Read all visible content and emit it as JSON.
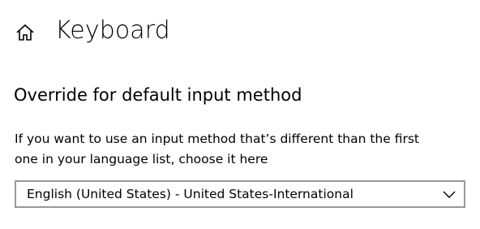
{
  "header": {
    "home_icon": "home-icon",
    "title": "Keyboard"
  },
  "section": {
    "title": "Override for default input method",
    "description_line1": "If you want to use an input method that’s different than the first",
    "description_line2": "one in your language list, choose it here"
  },
  "input_method_select": {
    "selected_value": "English (United States) - United States-International",
    "chevron_icon": "chevron-down-icon"
  },
  "colors": {
    "background": "#ffffff",
    "text": "#000000",
    "select_border": "#999999"
  }
}
